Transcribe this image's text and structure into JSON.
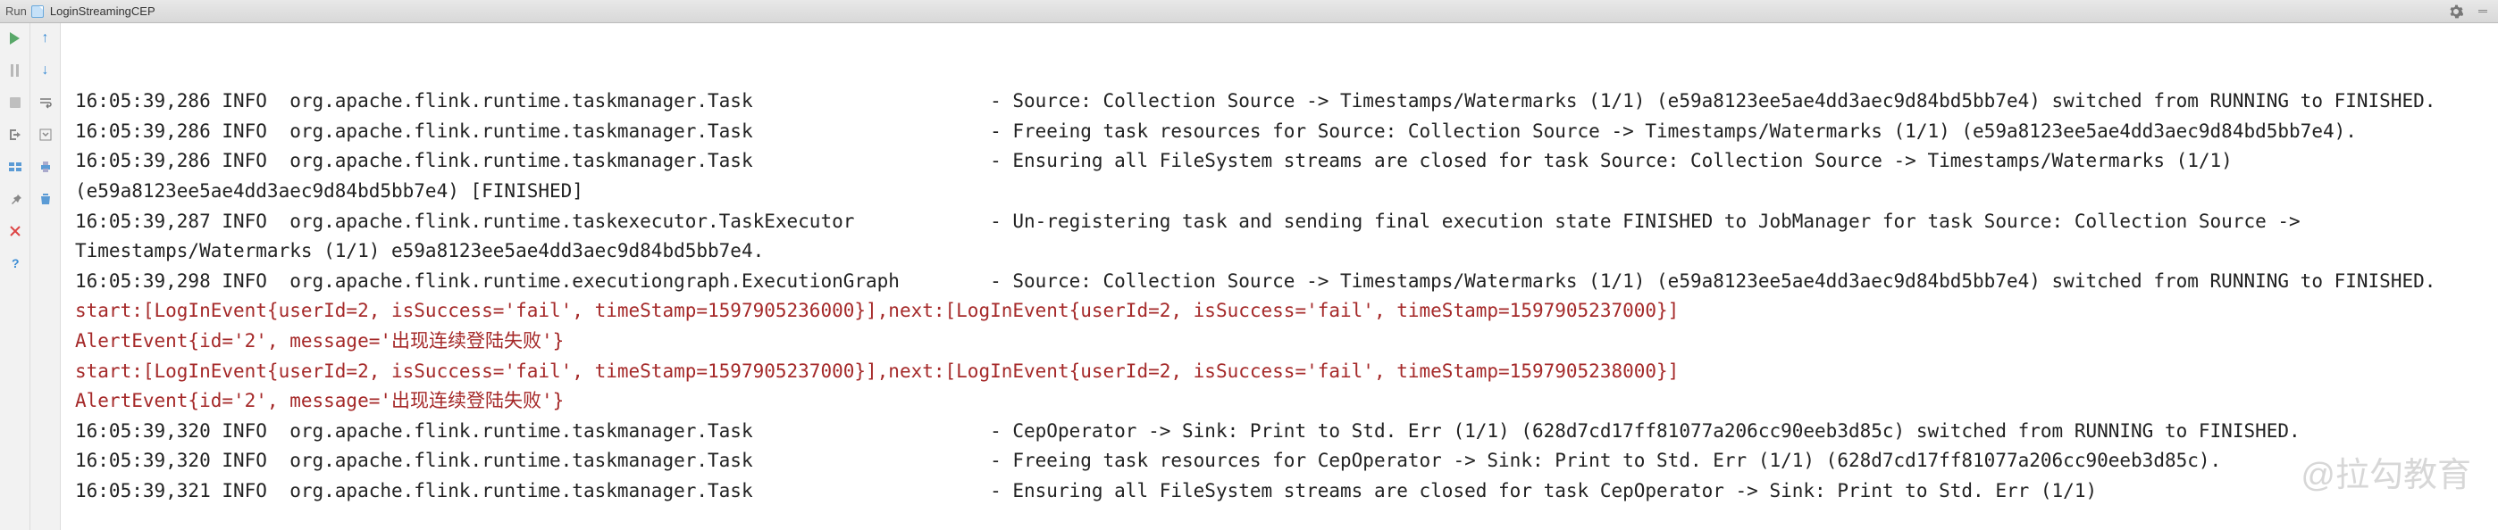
{
  "titleBar": {
    "runLabel": "Run",
    "configName": "LoginStreamingCEP"
  },
  "log": {
    "lines": [
      {
        "cls": "",
        "text": "16:05:39,286 INFO  org.apache.flink.runtime.taskmanager.Task                     - Source: Collection Source -> Timestamps/Watermarks (1/1) (e59a8123ee5ae4dd3aec9d84bd5bb7e4) switched from RUNNING to FINISHED."
      },
      {
        "cls": "",
        "text": "16:05:39,286 INFO  org.apache.flink.runtime.taskmanager.Task                     - Freeing task resources for Source: Collection Source -> Timestamps/Watermarks (1/1) (e59a8123ee5ae4dd3aec9d84bd5bb7e4)."
      },
      {
        "cls": "",
        "text": "16:05:39,286 INFO  org.apache.flink.runtime.taskmanager.Task                     - Ensuring all FileSystem streams are closed for task Source: Collection Source -> Timestamps/Watermarks (1/1) (e59a8123ee5ae4dd3aec9d84bd5bb7e4) [FINISHED]"
      },
      {
        "cls": "",
        "text": "16:05:39,287 INFO  org.apache.flink.runtime.taskexecutor.TaskExecutor            - Un-registering task and sending final execution state FINISHED to JobManager for task Source: Collection Source -> Timestamps/Watermarks (1/1) e59a8123ee5ae4dd3aec9d84bd5bb7e4."
      },
      {
        "cls": "",
        "text": "16:05:39,298 INFO  org.apache.flink.runtime.executiongraph.ExecutionGraph        - Source: Collection Source -> Timestamps/Watermarks (1/1) (e59a8123ee5ae4dd3aec9d84bd5bb7e4) switched from RUNNING to FINISHED."
      },
      {
        "cls": "log-red",
        "text": "start:[LogInEvent{userId=2, isSuccess='fail', timeStamp=1597905236000}],next:[LogInEvent{userId=2, isSuccess='fail', timeStamp=1597905237000}]"
      },
      {
        "cls": "log-red",
        "text": "AlertEvent{id='2', message='出现连续登陆失败'}"
      },
      {
        "cls": "log-red",
        "text": "start:[LogInEvent{userId=2, isSuccess='fail', timeStamp=1597905237000}],next:[LogInEvent{userId=2, isSuccess='fail', timeStamp=1597905238000}]"
      },
      {
        "cls": "log-red",
        "text": "AlertEvent{id='2', message='出现连续登陆失败'}"
      },
      {
        "cls": "",
        "text": "16:05:39,320 INFO  org.apache.flink.runtime.taskmanager.Task                     - CepOperator -> Sink: Print to Std. Err (1/1) (628d7cd17ff81077a206cc90eeb3d85c) switched from RUNNING to FINISHED."
      },
      {
        "cls": "",
        "text": "16:05:39,320 INFO  org.apache.flink.runtime.taskmanager.Task                     - Freeing task resources for CepOperator -> Sink: Print to Std. Err (1/1) (628d7cd17ff81077a206cc90eeb3d85c)."
      },
      {
        "cls": "",
        "text": "16:05:39,321 INFO  org.apache.flink.runtime.taskmanager.Task                     - Ensuring all FileSystem streams are closed for task CepOperator -> Sink: Print to Std. Err (1/1)"
      }
    ]
  },
  "watermark": "@拉勾教育",
  "colors": {
    "logRed": "#a52929",
    "playGreen": "#59a869",
    "arrowBlue": "#3b8cd4"
  }
}
